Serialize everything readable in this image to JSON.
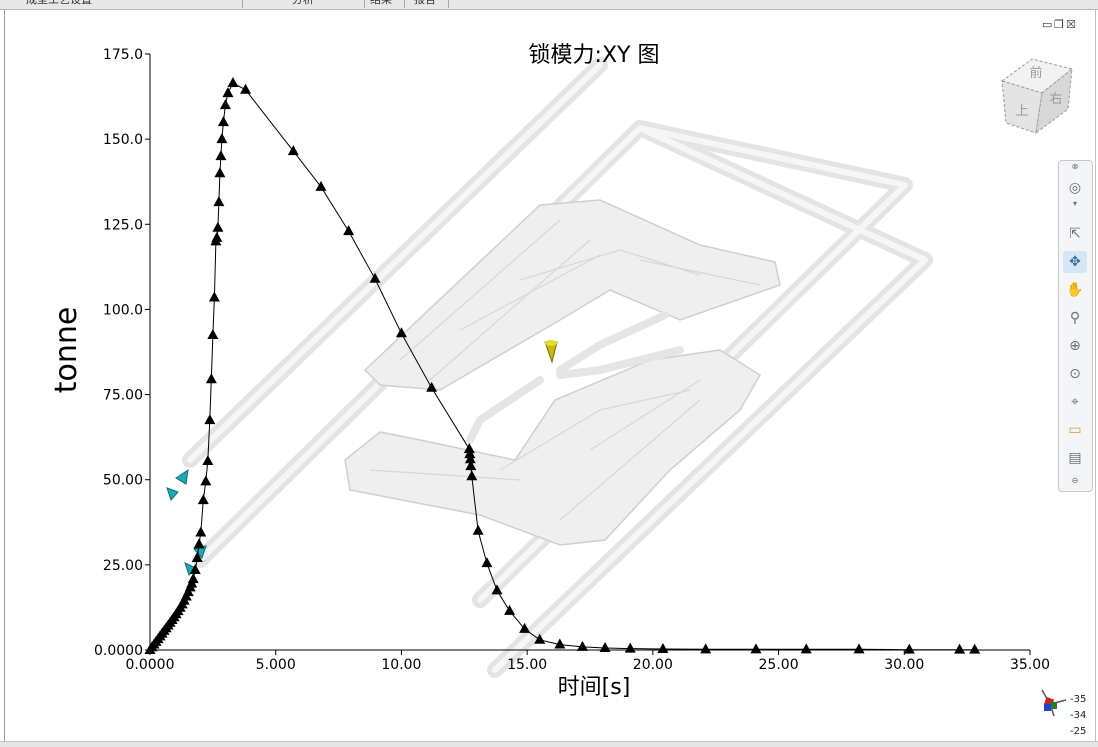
{
  "toolbar": {
    "tabs": [
      "成型工艺设置",
      "分析",
      "结果",
      "报告"
    ]
  },
  "window_controls": {
    "minimize": "▭",
    "restore": "❐",
    "close": "☒"
  },
  "view_cube": {
    "faces": [
      "前",
      "右",
      "上"
    ]
  },
  "nav_bar": {
    "items": [
      "steering-wheel-icon",
      "select-icon",
      "orbit-icon",
      "pan-icon",
      "zoom-icon",
      "zoom-window-icon",
      "zoom-extents-icon",
      "center-icon",
      "measure-icon",
      "section-icon"
    ]
  },
  "triad": {
    "values": [
      "-35",
      "-34",
      "-25"
    ]
  },
  "colors": {
    "series": "#000000",
    "model": "#bdbdbd",
    "gate": "#d4c400",
    "marker_cyan": "#1aa9b5"
  },
  "chart_data": {
    "type": "line",
    "title": "锁模力:XY 图",
    "xlabel": "时间[s]",
    "ylabel": "tonne",
    "xlim": [
      0,
      35
    ],
    "ylim": [
      0,
      175
    ],
    "xticks": [
      "0.0000",
      "5.000",
      "10.00",
      "15.00",
      "20.00",
      "25.00",
      "30.00",
      "35.00"
    ],
    "yticks": [
      "0.0000",
      "25.00",
      "50.00",
      "75.00",
      "100.0",
      "125.0",
      "150.0",
      "175.0"
    ],
    "marker": "triangle",
    "series": [
      {
        "x": [
          0.0,
          0.08,
          0.16,
          0.24,
          0.32,
          0.4,
          0.48,
          0.56,
          0.64,
          0.72,
          0.8,
          0.88,
          0.96,
          1.04,
          1.12,
          1.2,
          1.28,
          1.36,
          1.44,
          1.52,
          1.6,
          1.66,
          1.72,
          1.8,
          1.88,
          1.95,
          2.02,
          2.12,
          2.22,
          2.3,
          2.38,
          2.44,
          2.5,
          2.56,
          2.62,
          2.66,
          2.7,
          2.74,
          2.78,
          2.82,
          2.86,
          2.92,
          3.0,
          3.1,
          3.3,
          3.8,
          5.7,
          6.8,
          7.9,
          8.95,
          10.0,
          11.2,
          12.7,
          12.72,
          12.74,
          12.76,
          12.8,
          13.05,
          13.4,
          13.8,
          14.3,
          14.9,
          15.5,
          16.3,
          17.2,
          18.1,
          19.1,
          20.4,
          22.1,
          24.1,
          26.1,
          28.2,
          30.2,
          32.2,
          32.8
        ],
        "y": [
          0.0,
          0.8,
          1.6,
          2.4,
          3.2,
          4.0,
          4.8,
          5.6,
          6.4,
          7.2,
          8.0,
          8.8,
          9.6,
          10.5,
          11.4,
          12.4,
          13.4,
          14.5,
          15.7,
          17.0,
          18.4,
          19.5,
          20.8,
          23.5,
          27.0,
          31.0,
          34.5,
          44.0,
          49.5,
          55.5,
          67.5,
          79.5,
          92.5,
          103.5,
          120.0,
          121.0,
          124.0,
          131.5,
          140.0,
          145.0,
          150.0,
          155.0,
          160.0,
          163.5,
          166.5,
          164.5,
          146.5,
          136.0,
          123.0,
          109.0,
          93.0,
          77.0,
          59.0,
          57.5,
          56.0,
          54.0,
          51.0,
          35.0,
          25.5,
          17.5,
          11.5,
          6.2,
          3.0,
          1.6,
          0.9,
          0.6,
          0.4,
          0.3,
          0.2,
          0.2,
          0.2,
          0.2,
          0.1,
          0.1,
          0.1
        ]
      }
    ]
  }
}
